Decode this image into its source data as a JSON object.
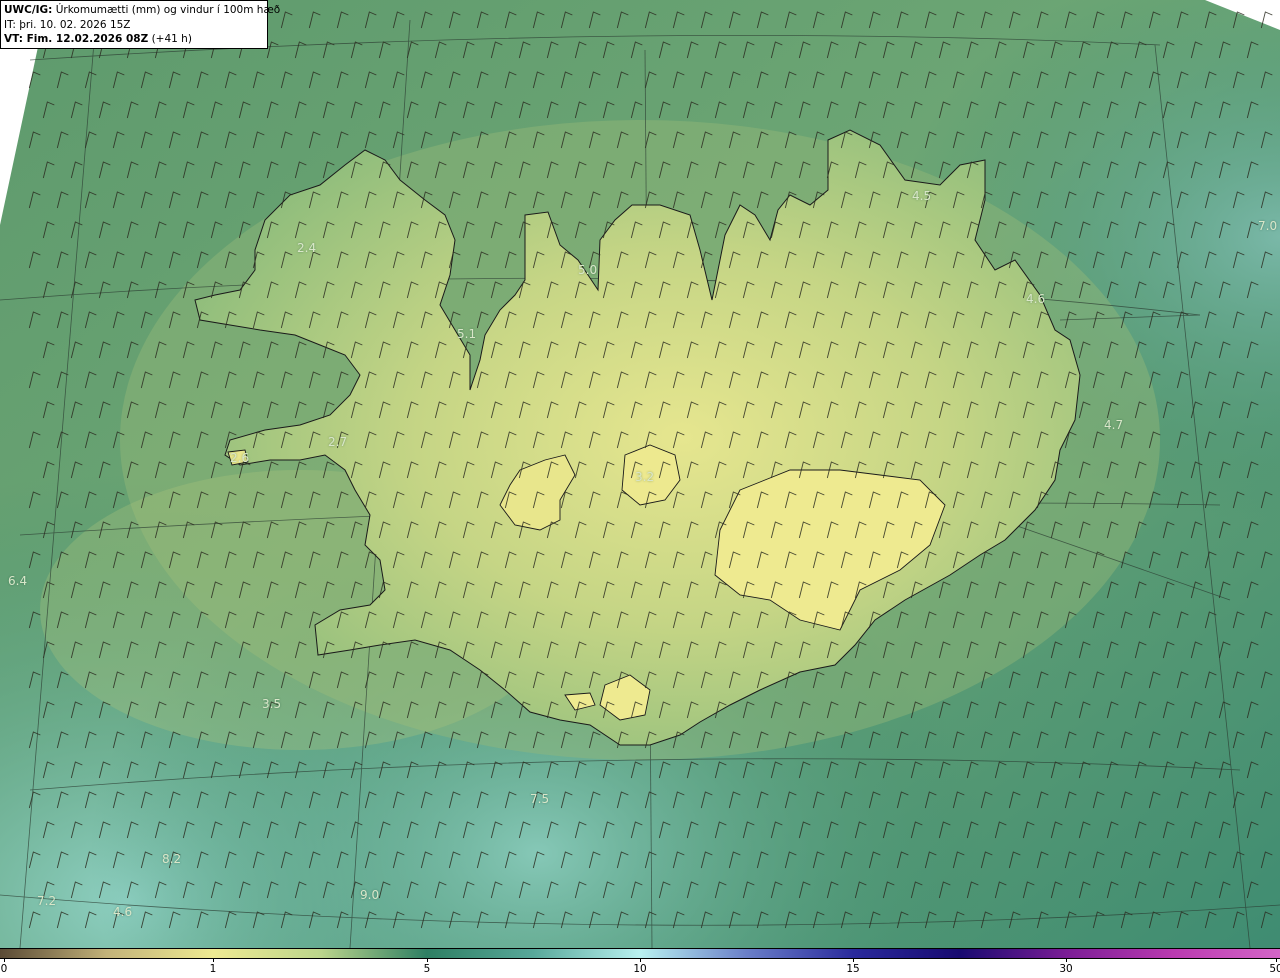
{
  "header": {
    "product": "UWC/IG:",
    "description": "Úrkomumætti (mm) og vindur í 100m hæð",
    "issue_time": "IT: þri. 10. 02. 2026 15Z",
    "valid_prefix": "VT: Fim. 12.02.2026 08Z",
    "valid_suffix": "(+41 h)"
  },
  "map_values": [
    "2.4",
    "5.0",
    "5.1",
    "4.5",
    "4.6",
    "7.0",
    "4.7",
    "2.7",
    "2.6",
    "3.2",
    "6.4",
    "3.5",
    "7.5",
    "8.2",
    "7.2",
    "4.6",
    "9.0"
  ],
  "colorbar": {
    "ticks": [
      "0",
      "1",
      "5",
      "10",
      "15",
      "30",
      "50"
    ],
    "tick_values": [
      0,
      1,
      5,
      10,
      15,
      30,
      50
    ],
    "colors": [
      "#5a4a35",
      "#c2b279",
      "#eeea92",
      "#bcd58c",
      "#2e7f63",
      "#58a89a",
      "#b9f1f0",
      "#6a7fc8",
      "#2a2a9c",
      "#180a70",
      "#7b1d96",
      "#ba3ab0",
      "#d466c8"
    ]
  }
}
